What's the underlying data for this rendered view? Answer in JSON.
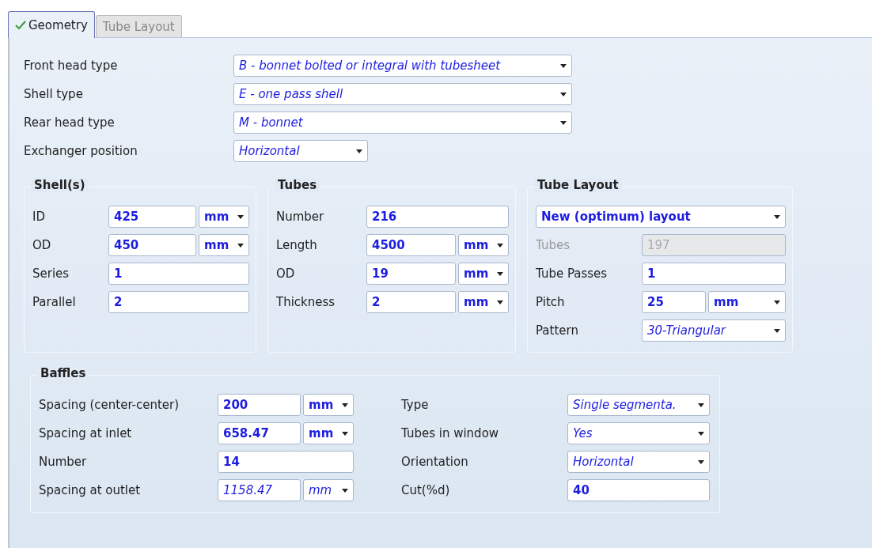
{
  "tabs": [
    {
      "label": "Geometry",
      "selected": true,
      "checked": true
    },
    {
      "label": "Tube Layout",
      "selected": false,
      "checked": false
    }
  ],
  "general": [
    {
      "label": "Front head type",
      "kind": "select",
      "value": "B - bonnet bolted or integral with tubesheet",
      "calculated": true
    },
    {
      "label": "Shell type",
      "kind": "select",
      "value": "E - one pass shell",
      "calculated": true
    },
    {
      "label": "Rear head type",
      "kind": "select",
      "value": "M - bonnet",
      "calculated": true
    },
    {
      "label": "Exchanger position",
      "kind": "short-select",
      "value": "Horizontal",
      "calculated": true
    }
  ],
  "shells": {
    "title": "Shell(s)",
    "rows": [
      {
        "label": "ID",
        "kind": "input",
        "value": "425",
        "calculated": false,
        "unit": {
          "value": "mm",
          "calculated": false
        }
      },
      {
        "label": "OD",
        "kind": "input",
        "value": "450",
        "calculated": false,
        "unit": {
          "value": "mm",
          "calculated": false
        }
      },
      {
        "label": "Series",
        "kind": "input",
        "value": "1",
        "calculated": false
      },
      {
        "label": "Parallel",
        "kind": "input",
        "value": "2",
        "calculated": false
      }
    ]
  },
  "tubes": {
    "title": "Tubes",
    "rows": [
      {
        "label": "Number",
        "kind": "input",
        "value": "216",
        "calculated": false
      },
      {
        "label": "Length",
        "kind": "input",
        "value": "4500",
        "calculated": false,
        "unit": {
          "value": "mm",
          "calculated": false
        }
      },
      {
        "label": "OD",
        "kind": "input",
        "value": "19",
        "calculated": false,
        "unit": {
          "value": "mm",
          "calculated": false
        }
      },
      {
        "label": "Thickness",
        "kind": "input",
        "value": "2",
        "calculated": false,
        "unit": {
          "value": "mm",
          "calculated": false
        }
      }
    ]
  },
  "tube_layout": {
    "title": "Tube Layout",
    "method": {
      "value": "New (optimum) layout",
      "calculated": false
    },
    "rows": [
      {
        "label": "Tubes",
        "kind": "input",
        "value": "197",
        "calculated": false,
        "disabled": true
      },
      {
        "label": "Tube Passes",
        "kind": "input",
        "value": "1",
        "calculated": false,
        "disabled": false
      },
      {
        "label": "Pitch",
        "kind": "input",
        "value": "25",
        "calculated": false,
        "disabled": false,
        "unit": {
          "value": "mm",
          "calculated": false
        }
      },
      {
        "label": "Pattern",
        "kind": "select",
        "value": "30-Triangular",
        "calculated": true,
        "disabled": false
      }
    ]
  },
  "baffles": {
    "title": "Baffles",
    "left": [
      {
        "label": "Spacing (center-center)",
        "kind": "input",
        "value": "200",
        "calculated": false,
        "unit": {
          "value": "mm",
          "calculated": false
        }
      },
      {
        "label": "Spacing at inlet",
        "kind": "input",
        "value": "658.47",
        "calculated": false,
        "unit": {
          "value": "mm",
          "calculated": false
        }
      },
      {
        "label": "Number",
        "kind": "input",
        "value": "14",
        "calculated": false
      },
      {
        "label": "Spacing at outlet",
        "kind": "input",
        "value": "1158.47",
        "calculated": true,
        "unit": {
          "value": "mm",
          "calculated": true
        }
      }
    ],
    "right": [
      {
        "label": "Type",
        "kind": "select",
        "value": "Single segmenta.",
        "calculated": true
      },
      {
        "label": "Tubes in window",
        "kind": "select",
        "value": "Yes",
        "calculated": true
      },
      {
        "label": "Orientation",
        "kind": "select",
        "value": "Horizontal",
        "calculated": true
      },
      {
        "label": "Cut(%d)",
        "kind": "input",
        "value": "40",
        "calculated": false
      }
    ]
  }
}
